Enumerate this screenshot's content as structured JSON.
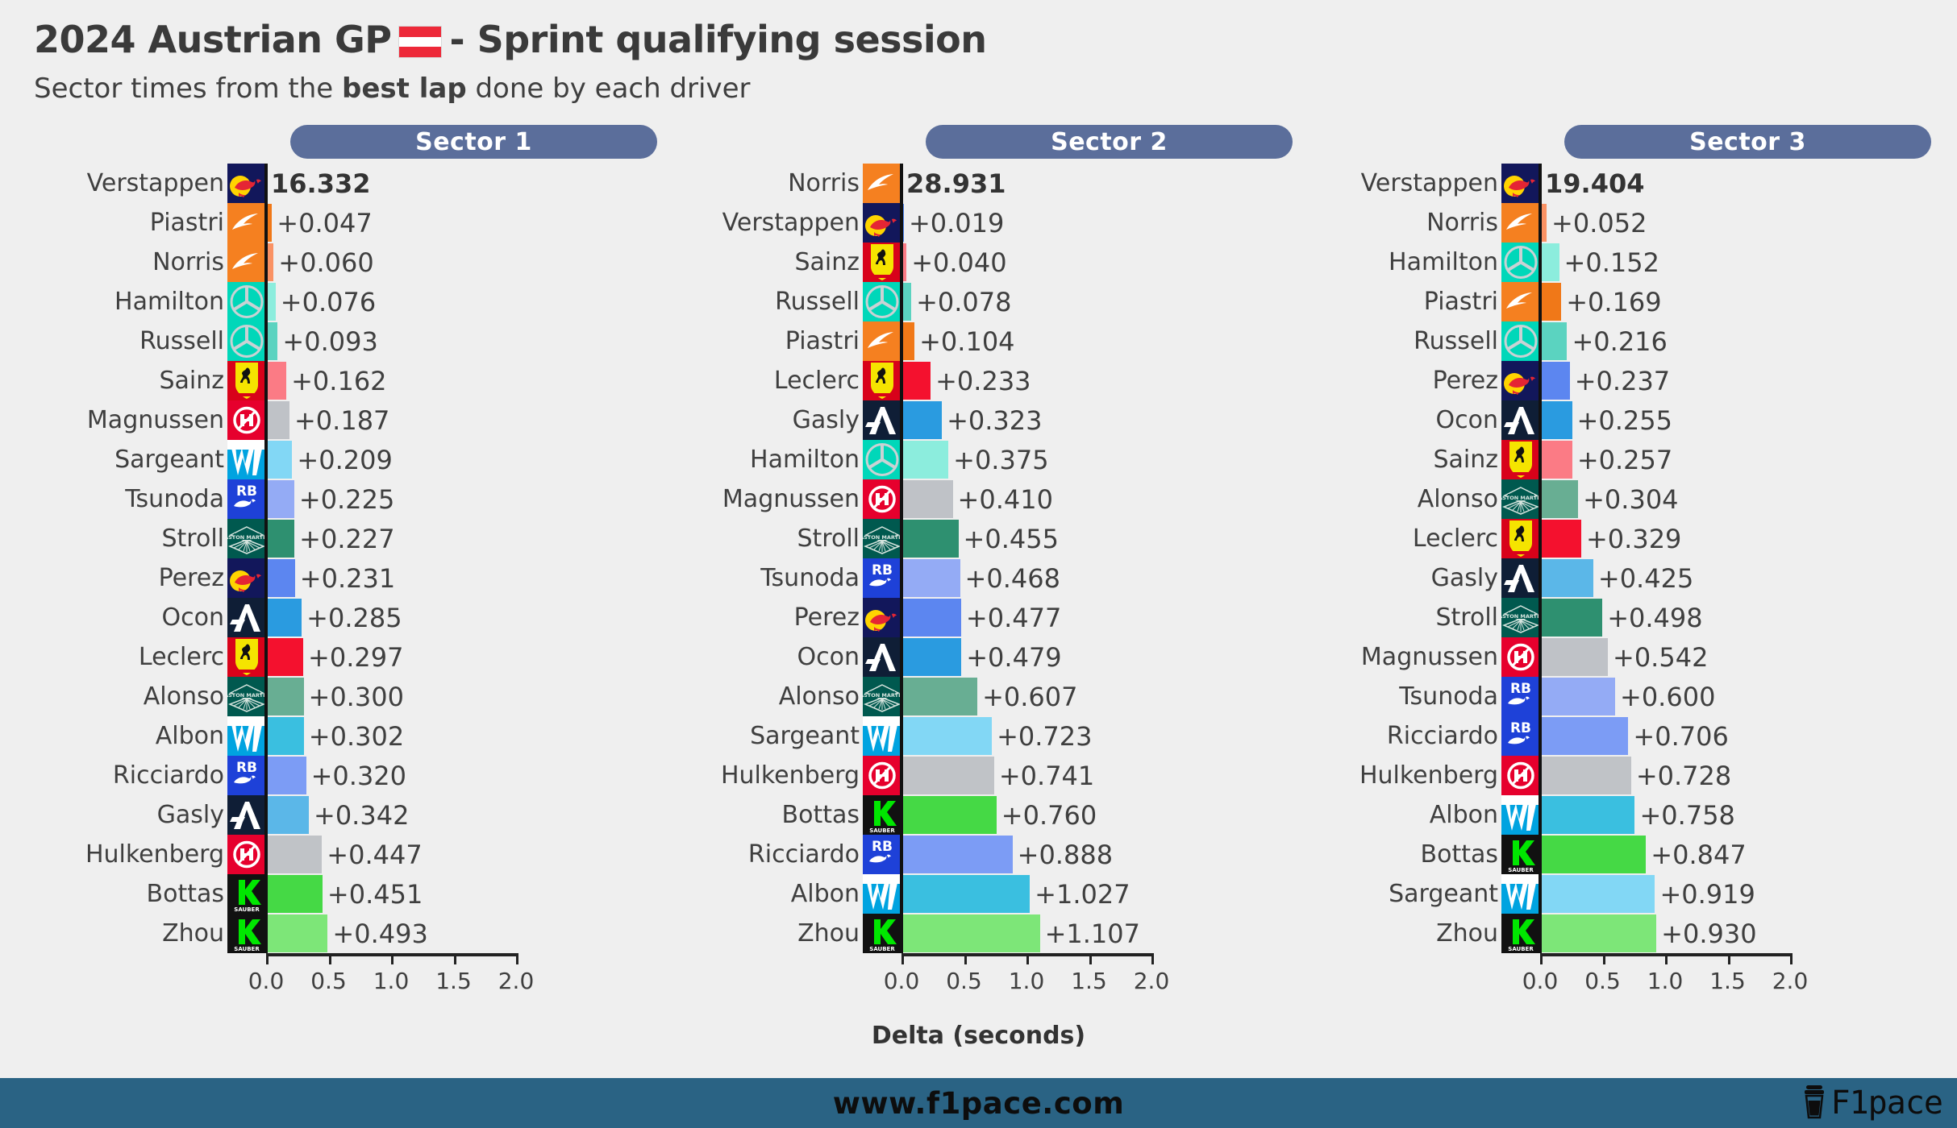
{
  "header": {
    "title_before_flag": "2024 Austrian GP",
    "flag": "austria-flag",
    "title_after_flag": "- Sprint qualifying session",
    "subtitle_before": "Sector times from the ",
    "subtitle_bold": "best lap",
    "subtitle_after": " done by each driver"
  },
  "axis": {
    "xlabel": "Delta (seconds)",
    "ticks": [
      "0.0",
      "0.5",
      "1.0",
      "1.5",
      "2.0"
    ],
    "tick_values": [
      0.0,
      0.5,
      1.0,
      1.5,
      2.0
    ],
    "xlim": [
      0.0,
      2.0
    ]
  },
  "footer": {
    "url": "www.f1pace.com",
    "brand": "F1pace",
    "brand_icon": "coffee-cup-icon",
    "bg": "#2a6384"
  },
  "team_colors": {
    "red_bull_1": "#4A7FE8",
    "red_bull_2": "#7C9CF5",
    "mclaren_1": "#F07818",
    "mclaren_2": "#FA9264",
    "mercedes_1": "#5BD3C0",
    "mercedes_2": "#8CEDDD",
    "ferrari_1": "#F4112E",
    "ferrari_2": "#FB7B85",
    "aston_1": "#2E9070",
    "aston_2": "#68AE93",
    "alpine_1": "#2A9BE0",
    "alpine_2": "#5BB7E8",
    "williams_1": "#3ABFE0",
    "williams_2": "#82D7F5",
    "rb_1": "#5C86F0",
    "rb_2": "#94ABF5",
    "haas_1": "#C0C3C7",
    "haas_2": "#BFC2C7",
    "sauber_1": "#45D945",
    "sauber_2": "#7DE678"
  },
  "chart_data": [
    {
      "type": "bar",
      "title": "Sector 1",
      "xlabel": "Delta (seconds)",
      "ylabel": "",
      "xlim": [
        0.0,
        2.0
      ],
      "orientation": "horizontal",
      "grid": false,
      "leader_time": "16.332",
      "categories": [
        "Verstappen",
        "Piastri",
        "Norris",
        "Hamilton",
        "Russell",
        "Sainz",
        "Magnussen",
        "Sargeant",
        "Tsunoda",
        "Stroll",
        "Perez",
        "Ocon",
        "Leclerc",
        "Alonso",
        "Albon",
        "Ricciardo",
        "Gasly",
        "Hulkenberg",
        "Bottas",
        "Zhou"
      ],
      "values": [
        0.0,
        0.047,
        0.06,
        0.076,
        0.093,
        0.162,
        0.187,
        0.209,
        0.225,
        0.227,
        0.231,
        0.285,
        0.297,
        0.3,
        0.302,
        0.32,
        0.342,
        0.447,
        0.451,
        0.493
      ],
      "labels": [
        "16.332",
        "+0.047",
        "+0.060",
        "+0.076",
        "+0.093",
        "+0.162",
        "+0.187",
        "+0.209",
        "+0.225",
        "+0.227",
        "+0.231",
        "+0.285",
        "+0.297",
        "+0.300",
        "+0.302",
        "+0.320",
        "+0.342",
        "+0.447",
        "+0.451",
        "+0.493"
      ],
      "teams": [
        "redbull",
        "mclaren",
        "mclaren",
        "mercedes",
        "mercedes",
        "ferrari",
        "haas",
        "williams",
        "rb",
        "aston",
        "redbull",
        "alpine",
        "ferrari",
        "aston",
        "williams",
        "rb",
        "alpine",
        "haas",
        "sauber",
        "sauber"
      ],
      "colors": [
        "#4A7FE8",
        "#F07818",
        "#FA9264",
        "#8CEDDD",
        "#5BD3C0",
        "#FB7B85",
        "#BFC2C7",
        "#82D7F5",
        "#94ABF5",
        "#2E9070",
        "#5C86F0",
        "#2A9BE0",
        "#F4112E",
        "#68AE93",
        "#3ABFE0",
        "#7C9CF5",
        "#5BB7E8",
        "#C0C3C7",
        "#45D945",
        "#7DE678"
      ]
    },
    {
      "type": "bar",
      "title": "Sector 2",
      "xlabel": "Delta (seconds)",
      "ylabel": "",
      "xlim": [
        0.0,
        2.0
      ],
      "orientation": "horizontal",
      "grid": false,
      "leader_time": "28.931",
      "categories": [
        "Norris",
        "Verstappen",
        "Sainz",
        "Russell",
        "Piastri",
        "Leclerc",
        "Gasly",
        "Hamilton",
        "Magnussen",
        "Stroll",
        "Tsunoda",
        "Perez",
        "Ocon",
        "Alonso",
        "Sargeant",
        "Hulkenberg",
        "Bottas",
        "Ricciardo",
        "Albon",
        "Zhou"
      ],
      "values": [
        0.0,
        0.019,
        0.04,
        0.078,
        0.104,
        0.233,
        0.323,
        0.375,
        0.41,
        0.455,
        0.468,
        0.477,
        0.479,
        0.607,
        0.723,
        0.741,
        0.76,
        0.888,
        1.027,
        1.107
      ],
      "labels": [
        "28.931",
        "+0.019",
        "+0.040",
        "+0.078",
        "+0.104",
        "+0.233",
        "+0.323",
        "+0.375",
        "+0.410",
        "+0.455",
        "+0.468",
        "+0.477",
        "+0.479",
        "+0.607",
        "+0.723",
        "+0.741",
        "+0.760",
        "+0.888",
        "+1.027",
        "+1.107"
      ],
      "teams": [
        "mclaren",
        "redbull",
        "ferrari",
        "mercedes",
        "mclaren",
        "ferrari",
        "alpine",
        "mercedes",
        "haas",
        "aston",
        "rb",
        "redbull",
        "alpine",
        "aston",
        "williams",
        "haas",
        "sauber",
        "rb",
        "williams",
        "sauber"
      ],
      "colors": [
        "#FA9264",
        "#4A7FE8",
        "#FB7B85",
        "#5BD3C0",
        "#F07818",
        "#F4112E",
        "#2A9BE0",
        "#8CEDDD",
        "#BFC2C7",
        "#2E9070",
        "#94ABF5",
        "#5C86F0",
        "#2A9BE0",
        "#68AE93",
        "#82D7F5",
        "#C0C3C7",
        "#45D945",
        "#7C9CF5",
        "#3ABFE0",
        "#7DE678"
      ]
    },
    {
      "type": "bar",
      "title": "Sector 3",
      "xlabel": "Delta (seconds)",
      "ylabel": "",
      "xlim": [
        0.0,
        2.0
      ],
      "orientation": "horizontal",
      "grid": false,
      "leader_time": "19.404",
      "categories": [
        "Verstappen",
        "Norris",
        "Hamilton",
        "Piastri",
        "Russell",
        "Perez",
        "Ocon",
        "Sainz",
        "Alonso",
        "Leclerc",
        "Gasly",
        "Stroll",
        "Magnussen",
        "Tsunoda",
        "Ricciardo",
        "Hulkenberg",
        "Albon",
        "Bottas",
        "Sargeant",
        "Zhou"
      ],
      "values": [
        0.0,
        0.052,
        0.152,
        0.169,
        0.216,
        0.237,
        0.255,
        0.257,
        0.304,
        0.329,
        0.425,
        0.498,
        0.542,
        0.6,
        0.706,
        0.728,
        0.758,
        0.847,
        0.919,
        0.93
      ],
      "labels": [
        "19.404",
        "+0.052",
        "+0.152",
        "+0.169",
        "+0.216",
        "+0.237",
        "+0.255",
        "+0.257",
        "+0.304",
        "+0.329",
        "+0.425",
        "+0.498",
        "+0.542",
        "+0.600",
        "+0.706",
        "+0.728",
        "+0.758",
        "+0.847",
        "+0.919",
        "+0.930"
      ],
      "teams": [
        "redbull",
        "mclaren",
        "mercedes",
        "mclaren",
        "mercedes",
        "redbull",
        "alpine",
        "ferrari",
        "aston",
        "ferrari",
        "alpine",
        "aston",
        "haas",
        "rb",
        "rb",
        "haas",
        "williams",
        "sauber",
        "williams",
        "sauber"
      ],
      "colors": [
        "#4A7FE8",
        "#FA9264",
        "#8CEDDD",
        "#F07818",
        "#5BD3C0",
        "#5C86F0",
        "#2A9BE0",
        "#FB7B85",
        "#68AE93",
        "#F4112E",
        "#5BB7E8",
        "#2E9070",
        "#BFC2C7",
        "#94ABF5",
        "#7C9CF5",
        "#C0C3C7",
        "#3ABFE0",
        "#45D945",
        "#82D7F5",
        "#7DE678"
      ]
    }
  ]
}
